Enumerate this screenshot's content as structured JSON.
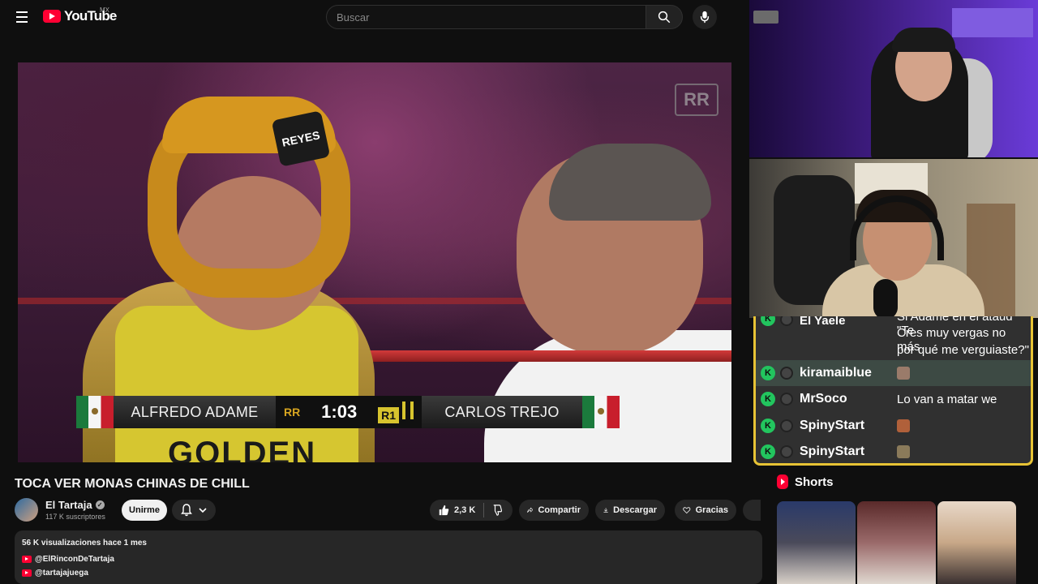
{
  "header": {
    "logo_text": "YouTube",
    "region": "MX",
    "search_placeholder": "Buscar"
  },
  "player": {
    "scoreboard": {
      "fighter_left": "ALFREDO ADAME",
      "fighter_right": "CARLOS TREJO",
      "time": "1:03",
      "round": "R1",
      "logo": "RR"
    },
    "jersey_text": "GOLDEN",
    "headgear_brand": "REYES",
    "watermark": "RR"
  },
  "video": {
    "title": "TOCA VER MONAS CHINAS DE CHILL",
    "channel": {
      "name": "El Tartaja",
      "subscribers": "117 K suscriptores",
      "verified": true
    },
    "actions": {
      "join_label": "Unirme",
      "likes": "2,3 K",
      "share_label": "Compartir",
      "download_label": "Descargar",
      "thanks_label": "Gracias"
    },
    "description": {
      "meta": "56 K visualizaciones  hace 1 mes",
      "links": [
        "@ElRinconDeTartaja",
        "@tartajajuega"
      ]
    }
  },
  "chat": {
    "top_partial_name": "El Yaele",
    "top_partial_msg": "Si Adame en el ataúd \"Te",
    "top_line1": "Cres muy vergas no más",
    "top_line2": "por qué me verguiaste?\"",
    "rows": [
      {
        "name": "kiramaiblue",
        "message": "",
        "emote_color": "#9a7b6a",
        "highlight": true
      },
      {
        "name": "MrSoco",
        "message": "Lo van a matar we",
        "emote_color": "",
        "highlight": false
      },
      {
        "name": "SpinyStart",
        "message": "",
        "emote_color": "#b0603a",
        "highlight": false
      },
      {
        "name": "SpinyStart",
        "message": "",
        "emote_color": "#8a7a5a",
        "highlight": false
      }
    ]
  },
  "shorts": {
    "title": "Shorts",
    "items": [
      {
        "color": "#3a4a7a"
      },
      {
        "color": "#6a2a3a"
      },
      {
        "color": "#d8b8a0"
      }
    ]
  },
  "colors": {
    "brand_red": "#ff0033",
    "chat_border": "#e7c335",
    "badge_green": "#22c55e"
  }
}
